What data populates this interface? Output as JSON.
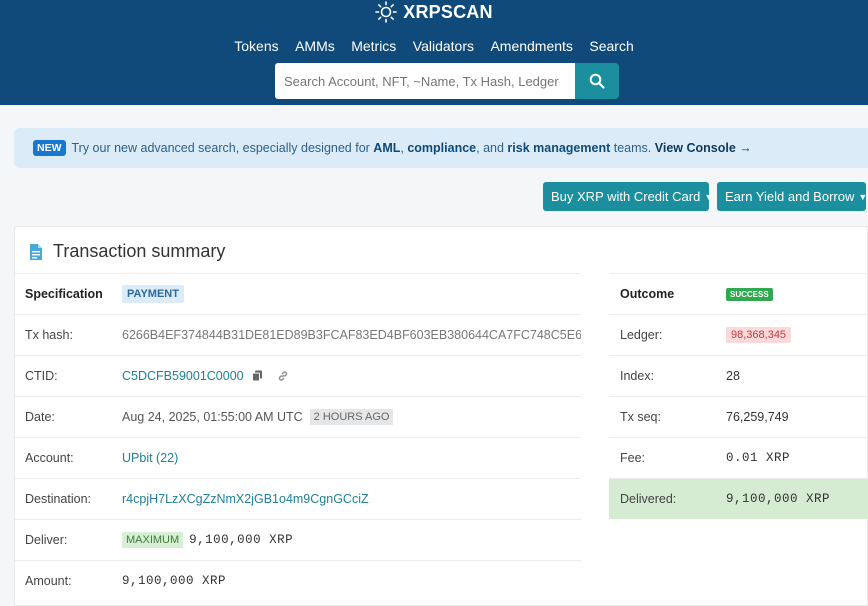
{
  "header": {
    "brand": "XRPSCAN",
    "nav": [
      "Tokens",
      "AMMs",
      "Metrics",
      "Validators",
      "Amendments",
      "Search"
    ],
    "search_placeholder": "Search Account, NFT, ~Name, Tx Hash, Ledger"
  },
  "banner": {
    "badge": "NEW",
    "text1": "Try our new advanced search, especially designed for",
    "aml": "AML",
    "sep1": ",",
    "compliance": "compliance",
    "sep2": ", and",
    "risk": "risk management",
    "text2": "teams.",
    "view_console": "View Console →"
  },
  "actions": {
    "buy": "Buy XRP with Credit Card",
    "earn": "Earn Yield and Borrow"
  },
  "summary": {
    "title": "Transaction summary",
    "left": {
      "specification_label": "Specification",
      "specification_value": "PAYMENT",
      "txhash_label": "Tx hash:",
      "txhash_value": "6266B4EF374844B31DE81ED89B3FCAF83ED4BF603EB380644CA7FC748C5E6",
      "ctid_label": "CTID:",
      "ctid_value": "C5DCFB59001C0000",
      "date_label": "Date:",
      "date_value": "Aug 24, 2025, 01:55:00 AM UTC",
      "date_ago": "2 HOURS AGO",
      "account_label": "Account:",
      "account_value": "UPbit (22)",
      "destination_label": "Destination:",
      "destination_value": "r4cpjH7LzXCgZzNmX2jGB1o4m9CgnGCciZ",
      "deliver_label": "Deliver:",
      "deliver_tag": "MAXIMUM",
      "deliver_value": "9,100,000 XRP",
      "amount_label": "Amount:",
      "amount_value": "9,100,000 XRP"
    },
    "right": {
      "outcome_label": "Outcome",
      "outcome_value": "SUCCESS",
      "ledger_label": "Ledger:",
      "ledger_value": "98,368,345",
      "index_label": "Index:",
      "index_value": "28",
      "txseq_label": "Tx seq:",
      "txseq_value": "76,259,749",
      "fee_label": "Fee:",
      "fee_value": "0.01 XRP",
      "delivered_label": "Delivered:",
      "delivered_value": "9,100,000 XRP"
    }
  },
  "icons": {
    "brand": "sun-icon",
    "search": "search-icon",
    "doc": "document-icon",
    "copy": "copy-icon",
    "link": "link-icon"
  },
  "colors": {
    "header": "#0f4a7a",
    "accent": "#1b8f9e",
    "success": "#2fa84f",
    "delivered_bg": "#d6ecd2"
  }
}
